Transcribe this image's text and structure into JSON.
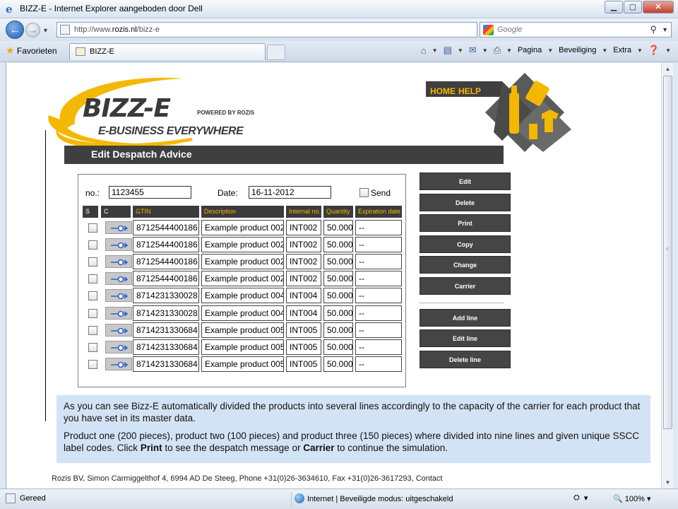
{
  "window": {
    "title": "BIZZ-E - Internet Explorer aangeboden door Dell"
  },
  "address": {
    "url_prefix": "http://www.",
    "url_domain": "rozis.nl",
    "url_path": "/bizz-e",
    "search_placeholder": "Google"
  },
  "tabs": {
    "favorites": "Favorieten",
    "active_tab": "BIZZ-E"
  },
  "commandbar": {
    "page": "Pagina",
    "security": "Beveiliging",
    "extra": "Extra"
  },
  "status": {
    "text": "Gereed",
    "zone": "Internet | Beveiligde modus: uitgeschakeld",
    "zoom": "100%"
  },
  "logo": {
    "brand": "BIZZ-E",
    "powered": "POWERED BY ROZIS",
    "tagline": "E-BUSINESS EVERYWHERE"
  },
  "nav": {
    "home": "HOME",
    "help": "HELP"
  },
  "page": {
    "title": "Edit Despatch Advice"
  },
  "form": {
    "no_label": "no.:",
    "no_value": "1123455",
    "date_label": "Date:",
    "date_value": "16-11-2012",
    "send_label": "Send"
  },
  "table": {
    "headers": [
      "S",
      "C",
      "GTIN",
      "Description",
      "Internal no.",
      "Quantity",
      "Expiration date"
    ],
    "rows": [
      {
        "gtin": "8712544400186",
        "desc": "Example product 002",
        "internal": "INT002",
        "qty": "50.000",
        "exp": "--"
      },
      {
        "gtin": "8712544400186",
        "desc": "Example product 002",
        "internal": "INT002",
        "qty": "50.000",
        "exp": "--"
      },
      {
        "gtin": "8712544400186",
        "desc": "Example product 002",
        "internal": "INT002",
        "qty": "50.000",
        "exp": "--"
      },
      {
        "gtin": "8712544400186",
        "desc": "Example product 002",
        "internal": "INT002",
        "qty": "50.000",
        "exp": "--"
      },
      {
        "gtin": "8714231330028",
        "desc": "Example product 004",
        "internal": "INT004",
        "qty": "50.000",
        "exp": "--"
      },
      {
        "gtin": "8714231330028",
        "desc": "Example product 004",
        "internal": "INT004",
        "qty": "50.000",
        "exp": "--"
      },
      {
        "gtin": "8714231330684",
        "desc": "Example product 005",
        "internal": "INT005",
        "qty": "50.000",
        "exp": "--"
      },
      {
        "gtin": "8714231330684",
        "desc": "Example product 005",
        "internal": "INT005",
        "qty": "50.000",
        "exp": "--"
      },
      {
        "gtin": "8714231330684",
        "desc": "Example product 005",
        "internal": "INT005",
        "qty": "50.000",
        "exp": "--"
      }
    ]
  },
  "actions": {
    "edit": "Edit",
    "delete": "Delete",
    "print": "Print",
    "copy": "Copy",
    "change": "Change",
    "carrier": "Carrier",
    "add_line": "Add line",
    "edit_line": "Edit line",
    "delete_line": "Delete line"
  },
  "info": {
    "p1": "As you can see Bizz-E automatically divided the products into several lines accordingly to the capacity of the carrier for each product that you have set in its master data.",
    "p2_start": "Product one (200 pieces), product two (100 pieces) and product three (150 pieces) where divided into nine lines and given unique SSCC label codes. Click ",
    "p2_print": "Print",
    "p2_mid": " to see the despatch message or ",
    "p2_carrier": "Carrier",
    "p2_end": " to continue the simulation."
  },
  "footer": {
    "text": "Rozis BV, Simon Carmiggelthof 4, 6994 AD De Steeg, Phone +31(0)26-3634610, Fax +31(0)26-3617293, Contact"
  },
  "colors": {
    "accent_yellow": "#f5b800",
    "dark_bar": "#3f3f3f",
    "info_bg": "#d3e3f6"
  }
}
